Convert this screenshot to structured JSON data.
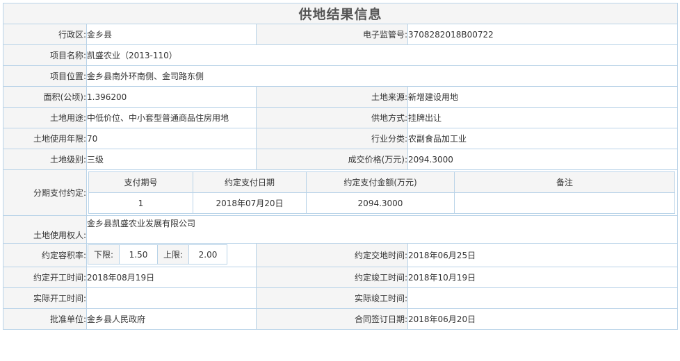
{
  "title": "供地结果信息",
  "rows": {
    "xzq": {
      "label": "行政区:",
      "value": "金乡县"
    },
    "dzjgh": {
      "label": "电子监管号:",
      "value": "3708282018B00722"
    },
    "xmmc": {
      "label": "项目名称:",
      "value": "凯盛农业（2013-110）"
    },
    "xmwz": {
      "label": "项目位置:",
      "value": "金乡县南外环南侧、金司路东侧"
    },
    "mj": {
      "label": "面积(公顷):",
      "value": "1.396200"
    },
    "tdly": {
      "label": "土地来源:",
      "value": "新增建设用地"
    },
    "tdyt": {
      "label": "土地用途:",
      "value": "中低价位、中小套型普通商品住房用地"
    },
    "gdfs": {
      "label": "供地方式:",
      "value": "挂牌出让"
    },
    "synx": {
      "label": "土地使用年限:",
      "value": "70"
    },
    "hyfl": {
      "label": "行业分类:",
      "value": "农副食品加工业"
    },
    "tdjb": {
      "label": "土地级别:",
      "value": "三级"
    },
    "cjjg": {
      "label": "成交价格(万元):",
      "value": "2094.3000"
    },
    "fqzf": {
      "label": "分期支付约定:"
    },
    "syqr": {
      "label": "土地使用权人:",
      "value": "金乡县凯盛农业发展有限公司"
    },
    "rjl": {
      "label": "约定容积率:"
    },
    "jdsj": {
      "label": "约定交地时间:",
      "value": "2018年06月25日"
    },
    "kgsj": {
      "label": "约定开工时间:",
      "value": "2018年08月19日"
    },
    "jgsj": {
      "label": "约定竣工时间:",
      "value": "2018年10月19日"
    },
    "sjkg": {
      "label": "实际开工时间:",
      "value": ""
    },
    "sjjg": {
      "label": "实际竣工时间:",
      "value": ""
    },
    "pzdw": {
      "label": "批准单位:",
      "value": "金乡县人民政府"
    },
    "htqd": {
      "label": "合同签订日期:",
      "value": "2018年06月20日"
    }
  },
  "installment": {
    "headers": [
      "支付期号",
      "约定支付日期",
      "约定支付金额(万元)",
      "备注"
    ],
    "rows": [
      {
        "no": "1",
        "date": "2018年07月20日",
        "amount": "2094.3000",
        "note": ""
      }
    ]
  },
  "far": {
    "lower_label": "下限:",
    "lower_value": "1.50",
    "upper_label": "上限:",
    "upper_value": "2.00"
  }
}
